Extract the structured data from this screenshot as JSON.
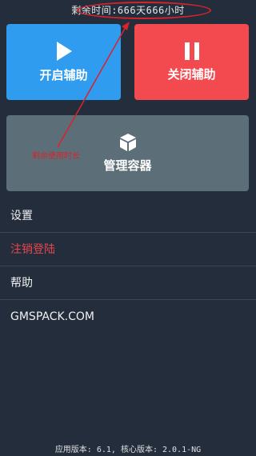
{
  "status": {
    "remaining_time": "剩余时间:666天666小时"
  },
  "buttons": {
    "start_label": "开启辅助",
    "stop_label": "关闭辅助",
    "manage_label": "管理容器"
  },
  "annotation": {
    "text": "剩余使用时长"
  },
  "menu": {
    "items": [
      {
        "label": "设置"
      },
      {
        "label": "注销登陆"
      },
      {
        "label": "帮助"
      },
      {
        "label": "GMSPACK.COM"
      }
    ]
  },
  "footer": {
    "version": "应用版本: 6.1, 核心版本: 2.0.1-NG"
  },
  "colors": {
    "background": "#232d3c",
    "start": "#2f9cf0",
    "stop": "#f24a4f",
    "manage": "#5c6e77",
    "annotation": "#d9232b"
  },
  "icons": {
    "start": "play-icon",
    "stop": "pause-icon",
    "manage": "cube-icon"
  }
}
